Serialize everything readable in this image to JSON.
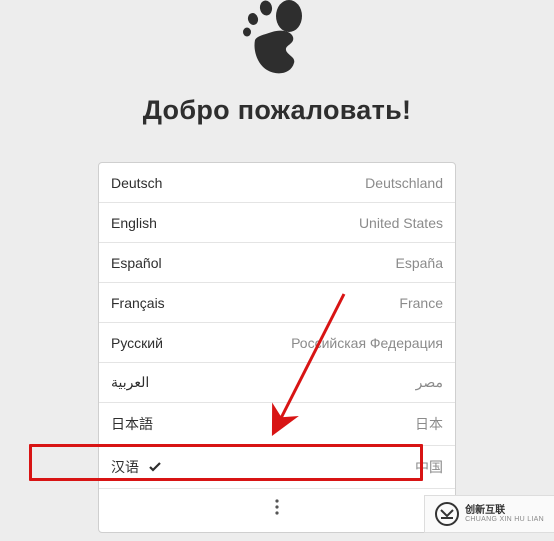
{
  "title": "Добро пожаловать!",
  "languages": [
    {
      "name": "Deutsch",
      "country": "Deutschland",
      "selected": false
    },
    {
      "name": "English",
      "country": "United States",
      "selected": false
    },
    {
      "name": "Español",
      "country": "España",
      "selected": false
    },
    {
      "name": "Français",
      "country": "France",
      "selected": false
    },
    {
      "name": "Русский",
      "country": "Российская Федерация",
      "selected": false
    },
    {
      "name": "العربية",
      "country": "مصر",
      "selected": false
    },
    {
      "name": "日本語",
      "country": "日本",
      "selected": false
    },
    {
      "name": "汉语",
      "country": "中国",
      "selected": true
    }
  ],
  "watermark": {
    "main": "创新互联",
    "sub": "CHUANG XIN HU LIAN"
  }
}
